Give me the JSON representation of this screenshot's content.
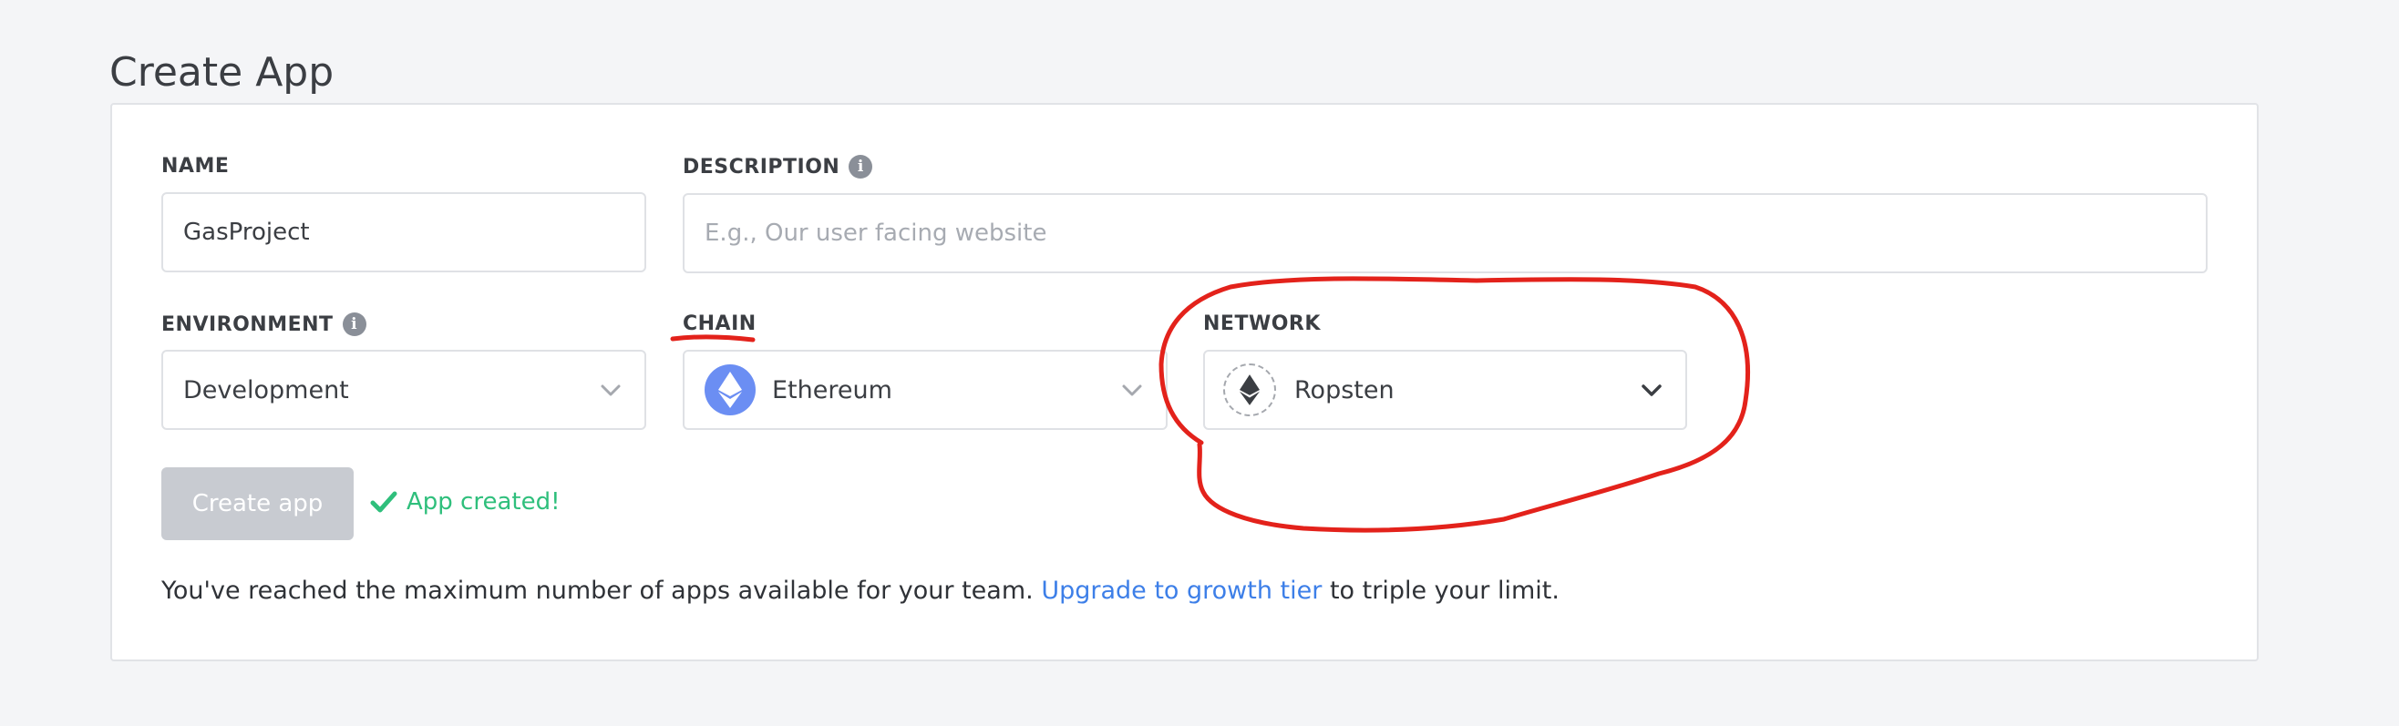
{
  "page": {
    "title": "Create App"
  },
  "form": {
    "name": {
      "label": "NAME",
      "value": "GasProject"
    },
    "description": {
      "label": "DESCRIPTION",
      "placeholder": "E.g., Our user facing website"
    },
    "environment": {
      "label": "ENVIRONMENT",
      "selected": "Development"
    },
    "chain": {
      "label": "CHAIN",
      "selected": "Ethereum"
    },
    "network": {
      "label": "NETWORK",
      "selected": "Ropsten"
    },
    "create_button": "Create app",
    "success_message": "App created!"
  },
  "footer": {
    "text_before": "You've reached the maximum number of apps available for your team. ",
    "link": "Upgrade to growth tier",
    "text_after": " to triple your limit."
  },
  "colors": {
    "accent_link": "#3d7fe8",
    "success": "#2fbf7c",
    "annotation": "#e3221b"
  },
  "icons": [
    "info-icon",
    "chevron-down-icon",
    "ethereum-icon",
    "check-icon"
  ]
}
